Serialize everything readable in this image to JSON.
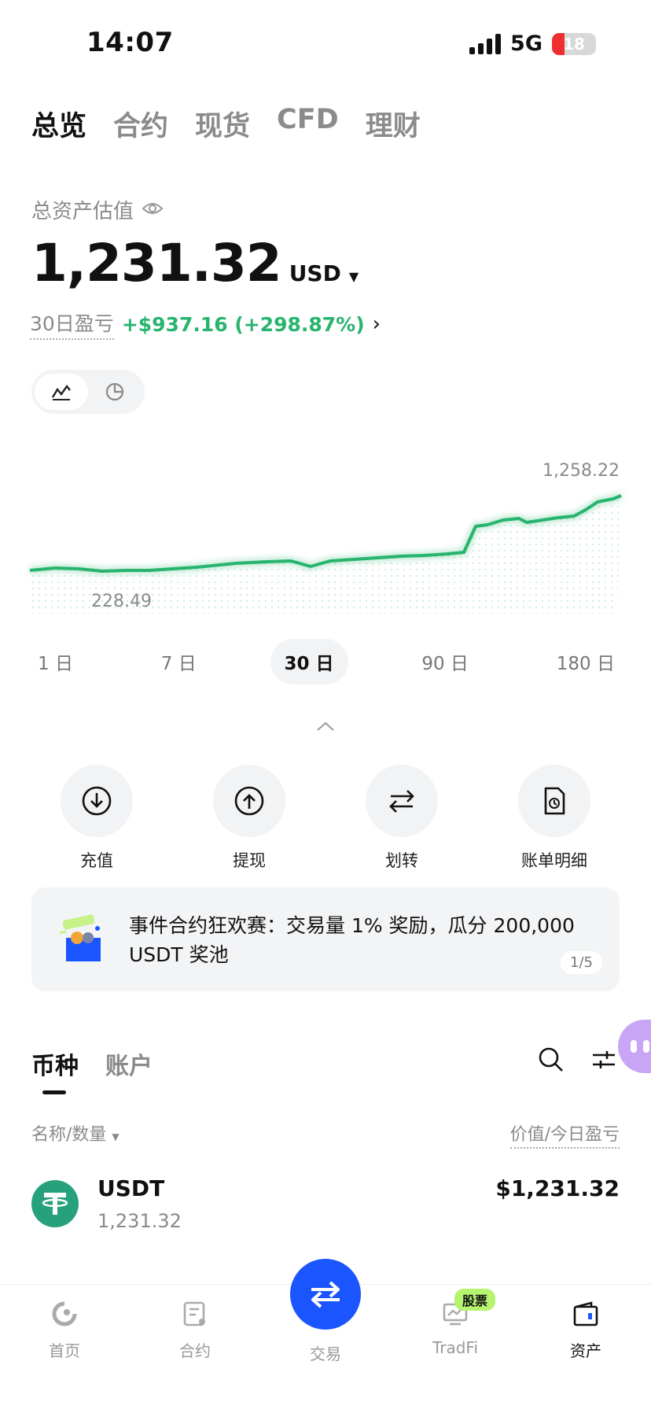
{
  "status": {
    "time": "14:07",
    "network": "5G",
    "battery": "18"
  },
  "tabs": [
    "总览",
    "合约",
    "现货",
    "CFD",
    "理财"
  ],
  "active_tab": 0,
  "total": {
    "label": "总资产估值",
    "value": "1,231.32",
    "currency": "USD"
  },
  "pnl": {
    "label": "30日盈亏",
    "value": "+$937.16 (+298.87%)"
  },
  "chart": {
    "max_label": "1,258.22",
    "min_label": "228.49"
  },
  "ranges": [
    "1 日",
    "7 日",
    "30 日",
    "90 日",
    "180 日"
  ],
  "active_range": 2,
  "actions": [
    {
      "label": "充值",
      "icon": "deposit-icon"
    },
    {
      "label": "提现",
      "icon": "withdraw-icon"
    },
    {
      "label": "划转",
      "icon": "transfer-icon"
    },
    {
      "label": "账单明细",
      "icon": "bill-icon"
    }
  ],
  "banner": {
    "text": "事件合约狂欢赛：交易量 1% 奖励，瓜分 200,000 USDT 奖池",
    "page": "1/5"
  },
  "sub_tabs": [
    "币种",
    "账户"
  ],
  "list_header": {
    "left": "名称/数量",
    "right": "价值/今日盈亏"
  },
  "asset_row": {
    "name": "USDT",
    "qty": "1,231.32",
    "value": "$1,231.32"
  },
  "nav": [
    {
      "label": "首页",
      "icon": "home-icon"
    },
    {
      "label": "合约",
      "icon": "contract-icon"
    },
    {
      "label": "交易",
      "icon": "trade-icon"
    },
    {
      "label": "TradFi",
      "icon": "tradfi-icon",
      "badge": "股票"
    },
    {
      "label": "资产",
      "icon": "wallet-icon"
    }
  ],
  "active_nav": 4,
  "colors": {
    "accent_green": "#27b46e",
    "primary_blue": "#1a55ff",
    "tether": "#26a17b"
  }
}
